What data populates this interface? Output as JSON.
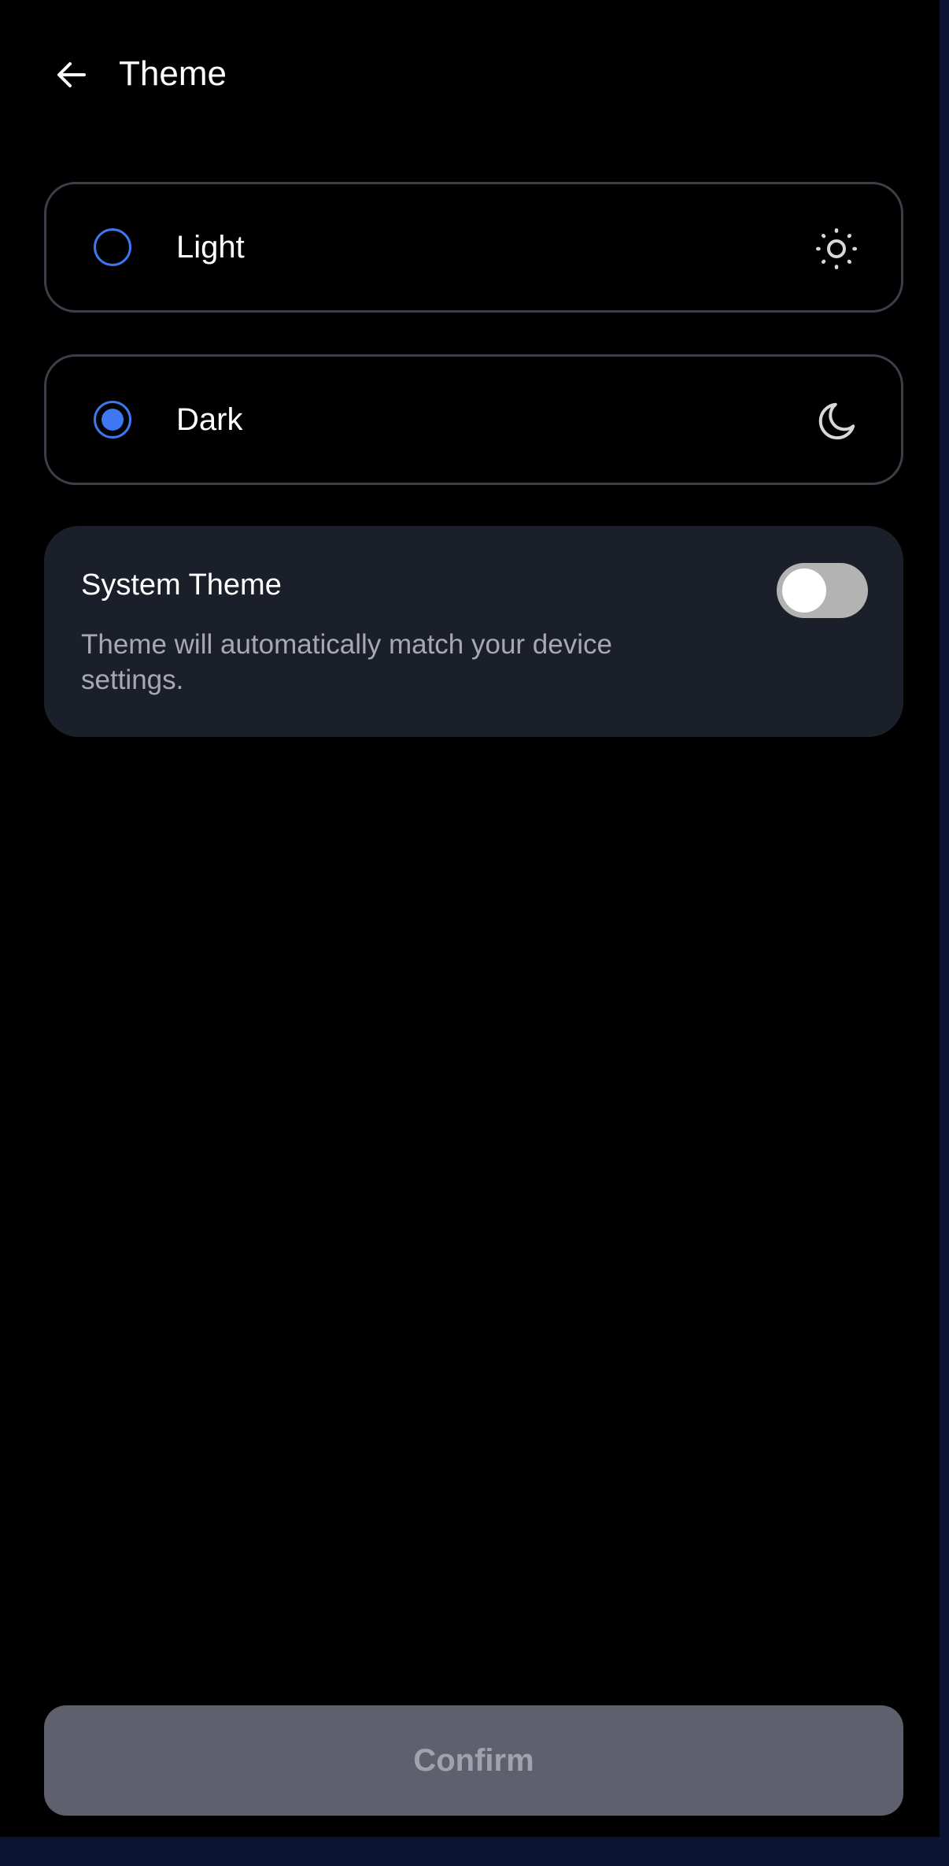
{
  "header": {
    "title": "Theme",
    "back_icon": "arrow-left-icon"
  },
  "options": [
    {
      "label": "Light",
      "selected": false,
      "icon": "sun-icon"
    },
    {
      "label": "Dark",
      "selected": true,
      "icon": "moon-icon"
    }
  ],
  "system_theme": {
    "title": "System Theme",
    "description": "Theme will automatically match your device settings.",
    "enabled": false
  },
  "footer": {
    "confirm_label": "Confirm",
    "confirm_enabled": false
  },
  "colors": {
    "background": "#000000",
    "accent": "#3f76f2",
    "card": "#1b1f29",
    "border": "#3c3f49",
    "button_disabled": "#5e606e",
    "outer_frame": "#0b1533"
  }
}
